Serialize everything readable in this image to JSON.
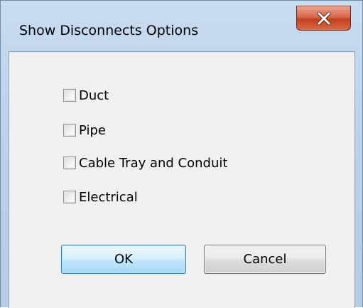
{
  "dialog": {
    "title": "Show Disconnects Options",
    "close_icon": "close-icon"
  },
  "options": [
    {
      "label": "Duct",
      "checked": false
    },
    {
      "label": "Pipe",
      "checked": false
    },
    {
      "label": "Cable Tray and Conduit",
      "checked": false
    },
    {
      "label": "Electrical",
      "checked": false
    }
  ],
  "buttons": {
    "ok_label": "OK",
    "cancel_label": "Cancel"
  },
  "colors": {
    "title_bar": "#c9dbef",
    "close_button": "#c2401f",
    "client_background": "#f0f0f0",
    "default_button_border": "#3c7fb1"
  }
}
